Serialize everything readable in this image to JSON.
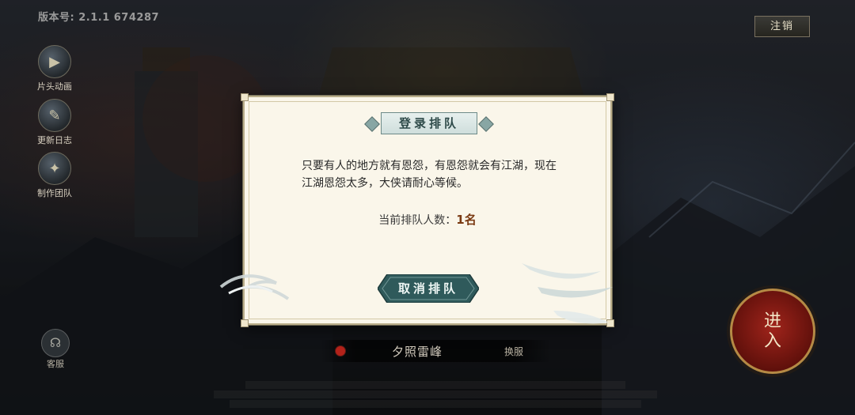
{
  "version": "版本号: 2.1.1 674287",
  "logout_label": "注销",
  "side_menu": [
    {
      "label": "片头动画",
      "icon": "film-icon"
    },
    {
      "label": "更新日志",
      "icon": "scroll-icon"
    },
    {
      "label": "制作团队",
      "icon": "team-icon"
    }
  ],
  "service_label": "客服",
  "enter_label": [
    "进",
    "入"
  ],
  "server": {
    "name": "夕照雷峰",
    "swap_label": "换服"
  },
  "dialog": {
    "title": "登录排队",
    "message": "只要有人的地方就有恩怨，有恩怨就会有江湖，现在江湖恩怨太多，大侠请耐心等候。",
    "queue_label": "当前排队人数：",
    "queue_value": "1名",
    "cancel_label": "取消排队"
  },
  "colors": {
    "accent": "#2f5a5b",
    "enter": "#a0241b",
    "count": "#7a3a12"
  }
}
